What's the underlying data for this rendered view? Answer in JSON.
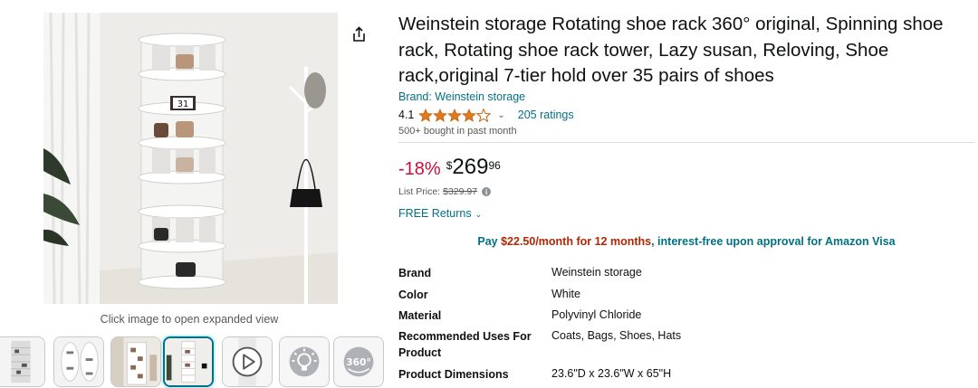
{
  "product": {
    "title": "Weinstein storage Rotating shoe rack 360° original, Spinning shoe rack, Rotating shoe rack tower, Lazy susan, Reloving, Shoe rack,original 7-tier hold over 35 pairs of shoes",
    "brand_link": "Brand: Weinstein storage",
    "rating_value": "4.1",
    "rating_stars": 4.1,
    "ratings_count": "205 ratings",
    "bought": "500+ bought in past month"
  },
  "gallery": {
    "caption": "Click image to open expanded view",
    "calendar_text": "31",
    "thumbnails": [
      {
        "name": "thumb-1"
      },
      {
        "name": "thumb-2"
      },
      {
        "name": "thumb-3"
      },
      {
        "name": "thumb-4"
      },
      {
        "name": "thumb-video"
      },
      {
        "name": "thumb-tips"
      },
      {
        "name": "thumb-360",
        "label": "360°"
      }
    ]
  },
  "price": {
    "discount": "-18%",
    "currency": "$",
    "whole": "269",
    "fraction": "96",
    "list_label": "List Price:",
    "list_value": "$329.97"
  },
  "returns": {
    "label": "FREE Returns"
  },
  "pay": {
    "prefix": "Pay ",
    "amount": "$22.50/month for 12 months",
    "suffix": ", interest-free upon approval for Amazon Visa"
  },
  "specs": [
    {
      "key": "Brand",
      "value": "Weinstein storage"
    },
    {
      "key": "Color",
      "value": "White"
    },
    {
      "key": "Material",
      "value": "Polyvinyl Chloride"
    },
    {
      "key": "Recommended Uses For Product",
      "value": "Coats, Bags, Shoes, Hats"
    },
    {
      "key": "Product Dimensions",
      "value": "23.6\"D x 23.6\"W x 65\"H"
    }
  ],
  "colors": {
    "link": "#007185",
    "discount": "#cc0c39",
    "star": "#de7921",
    "pay_amount": "#b12704"
  },
  "icons": {
    "share": "share-icon",
    "star": "star-icon",
    "chevron": "chevron-down-icon",
    "info": "info-icon",
    "play": "play-icon",
    "bulb": "lightbulb-icon",
    "rotate": "360-icon"
  }
}
